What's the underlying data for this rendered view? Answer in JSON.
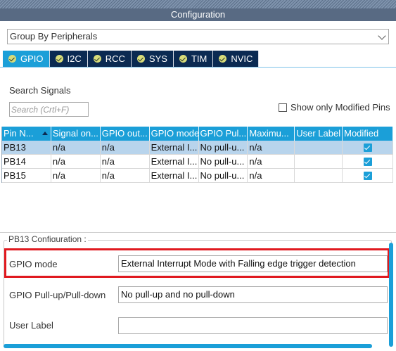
{
  "panel": {
    "title": "Configuration"
  },
  "grouping": {
    "selected": "Group By Peripherals"
  },
  "tabs": [
    {
      "label": "GPIO",
      "active": true,
      "icon": "check-circle-icon"
    },
    {
      "label": "I2C",
      "active": false,
      "icon": "check-circle-icon"
    },
    {
      "label": "RCC",
      "active": false,
      "icon": "check-circle-icon"
    },
    {
      "label": "SYS",
      "active": false,
      "icon": "check-circle-icon"
    },
    {
      "label": "TIM",
      "active": false,
      "icon": "check-circle-icon"
    },
    {
      "label": "NVIC",
      "active": false,
      "icon": "check-circle-icon"
    }
  ],
  "search": {
    "label": "Search Signals",
    "placeholder": "Search (Crtl+F)"
  },
  "modified_only": {
    "label": "Show only Modified Pins",
    "checked": false
  },
  "table": {
    "columns": [
      "Pin N...",
      "Signal on...",
      "GPIO out...",
      "GPIO mode",
      "GPIO Pul...",
      "Maximu...",
      "User Label",
      "Modified"
    ],
    "rows": [
      {
        "pin": "PB13",
        "signal": "n/a",
        "output": "n/a",
        "mode": "External I...",
        "pull": "No pull-u...",
        "max": "n/a",
        "label": "",
        "modified": true,
        "selected": true
      },
      {
        "pin": "PB14",
        "signal": "n/a",
        "output": "n/a",
        "mode": "External I...",
        "pull": "No pull-u...",
        "max": "n/a",
        "label": "",
        "modified": true,
        "selected": false
      },
      {
        "pin": "PB15",
        "signal": "n/a",
        "output": "n/a",
        "mode": "External I...",
        "pull": "No pull-u...",
        "max": "n/a",
        "label": "",
        "modified": true,
        "selected": false
      }
    ]
  },
  "config": {
    "legend": "PB13 Configuration :",
    "gpio_mode_label": "GPIO mode",
    "gpio_mode_value": "External Interrupt Mode with Falling edge trigger detection",
    "pull_label": "GPIO Pull-up/Pull-down",
    "pull_value": "No pull-up and no pull-down",
    "user_label_label": "User Label",
    "user_label_value": ""
  },
  "colors": {
    "accent": "#1b9fd8",
    "tab_dark": "#0b2a52",
    "title_bar": "#586a83",
    "highlight": "#e0191f"
  }
}
